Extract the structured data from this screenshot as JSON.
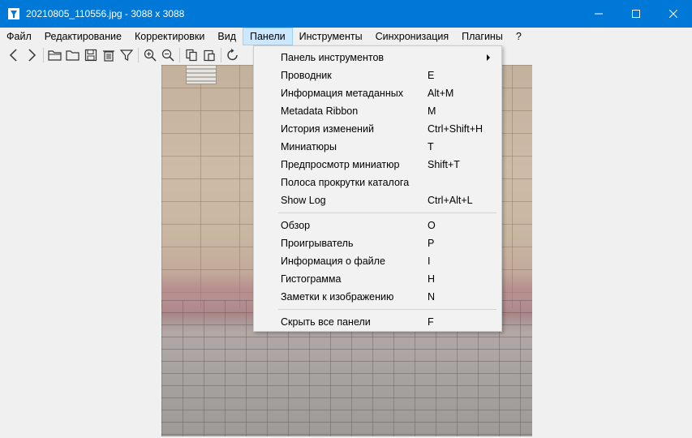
{
  "window": {
    "title": "20210805_110556.jpg  -  3088 x 3088",
    "controls": {
      "minimize": "minimize-icon",
      "maximize": "maximize-icon",
      "close": "close-icon"
    },
    "accent": "#0078d7"
  },
  "menubar": {
    "items": [
      {
        "label": "Файл"
      },
      {
        "label": "Редактирование"
      },
      {
        "label": "Корректировки"
      },
      {
        "label": "Вид"
      },
      {
        "label": "Панели",
        "active": true
      },
      {
        "label": "Инструменты"
      },
      {
        "label": "Синхронизация"
      },
      {
        "label": "Плагины"
      },
      {
        "label": "?"
      }
    ]
  },
  "toolbar": {
    "icons": [
      "back-icon",
      "forward-icon",
      "open-folder-icon",
      "folder-icon",
      "save-icon",
      "delete-icon",
      "filter-icon",
      "zoom-in-icon",
      "zoom-out-icon",
      "copy-icon",
      "paste-icon",
      "rotate-icon"
    ]
  },
  "panels_menu": {
    "items": [
      {
        "label": "Панель инструментов",
        "shortcut": "",
        "submenu": true
      },
      {
        "label": "Проводник",
        "shortcut": "E"
      },
      {
        "label": "Информация метаданных",
        "shortcut": "Alt+M"
      },
      {
        "label": "Metadata Ribbon",
        "shortcut": "M"
      },
      {
        "label": "История изменений",
        "shortcut": "Ctrl+Shift+H"
      },
      {
        "label": "Миниатюры",
        "shortcut": "T"
      },
      {
        "label": "Предпросмотр миниатюр",
        "shortcut": "Shift+T"
      },
      {
        "label": "Полоса прокрутки каталога",
        "shortcut": ""
      },
      {
        "label": "Show Log",
        "shortcut": "Ctrl+Alt+L"
      },
      {
        "separator": true
      },
      {
        "label": "Обзор",
        "shortcut": "O"
      },
      {
        "label": "Проигрыватель",
        "shortcut": "P"
      },
      {
        "label": "Информация о файле",
        "shortcut": "I"
      },
      {
        "label": "Гистограмма",
        "shortcut": "H"
      },
      {
        "label": "Заметки к изображению",
        "shortcut": "N"
      },
      {
        "separator": true
      },
      {
        "label": "Скрыть все панели",
        "shortcut": "F"
      }
    ]
  }
}
